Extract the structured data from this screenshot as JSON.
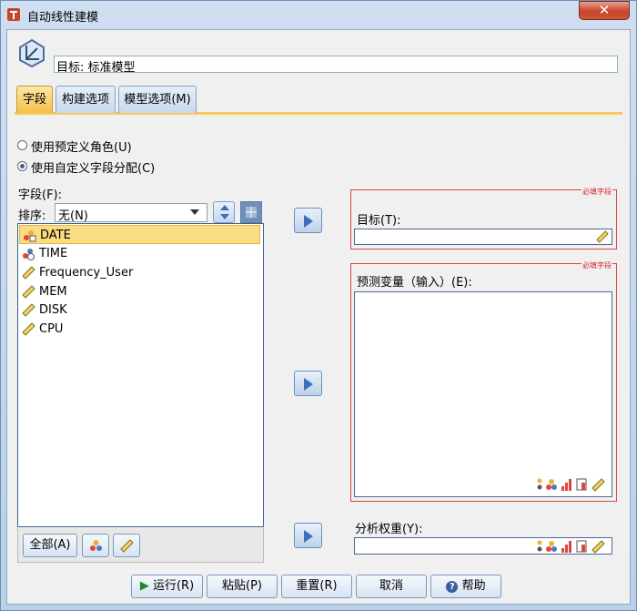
{
  "window": {
    "title": "自动线性建模",
    "close_label": "✕"
  },
  "header": {
    "target_text": "目标: 标准模型"
  },
  "tabs": [
    {
      "label": "字段",
      "active": true
    },
    {
      "label": "构建选项",
      "active": false
    },
    {
      "label": "模型选项(M)",
      "active": false
    }
  ],
  "roles": {
    "predefined_label": "使用预定义角色(U)",
    "custom_label": "使用自定义字段分配(C)",
    "selected": "custom"
  },
  "fields": {
    "label": "字段(F):",
    "sort_label": "排序:",
    "sort_value": "无(N)",
    "items": [
      {
        "name": "DATE",
        "icon": "nominal-date-icon",
        "selected": true
      },
      {
        "name": "TIME",
        "icon": "nominal-time-icon",
        "selected": false
      },
      {
        "name": "Frequency_User",
        "icon": "scale-ruler-icon",
        "selected": false
      },
      {
        "name": "MEM",
        "icon": "scale-ruler-icon",
        "selected": false
      },
      {
        "name": "DISK",
        "icon": "scale-ruler-icon",
        "selected": false
      },
      {
        "name": "CPU",
        "icon": "scale-ruler-icon",
        "selected": false
      }
    ],
    "all_button": "全部(A)"
  },
  "target": {
    "required_tag": "必填字段",
    "caption": "目标(T):",
    "value": ""
  },
  "predictors": {
    "required_tag": "必填字段",
    "caption": "预测变量（输入）(E):"
  },
  "weight": {
    "caption": "分析权重(Y):",
    "value": ""
  },
  "buttons": {
    "run": "运行(R)",
    "paste": "粘贴(P)",
    "reset": "重置(R)",
    "cancel": "取消",
    "help": "帮助"
  },
  "colors": {
    "accent": "#f6c04a",
    "required": "#dd4444",
    "selection": "#fbdc83"
  }
}
